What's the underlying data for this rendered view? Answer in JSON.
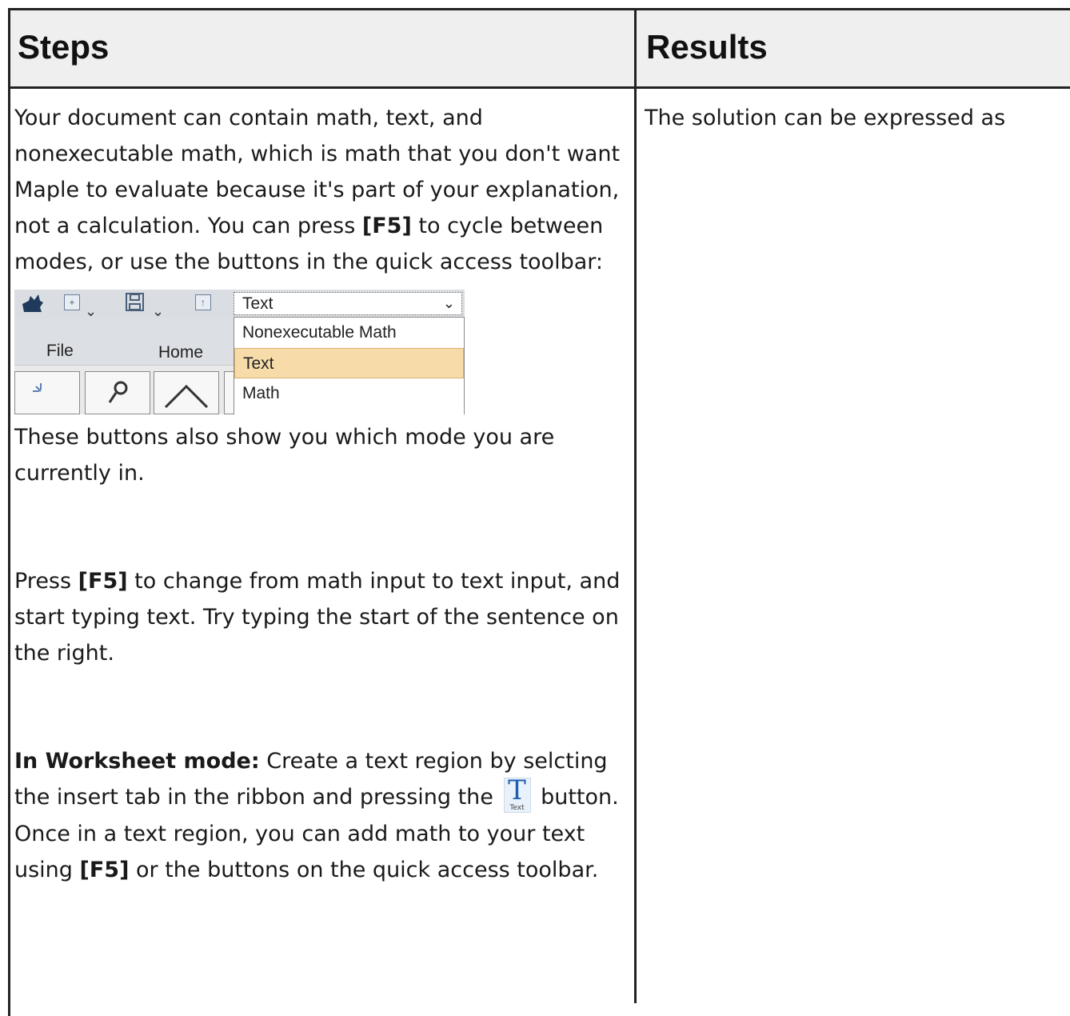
{
  "header": {
    "steps": "Steps",
    "results": "Results"
  },
  "steps": {
    "para1": "Your document can contain math, text, and nonexecutable math, which is math that you don't want Maple to evaluate because it's part of your explanation, not a calculation. You can press ",
    "para1_key": "[F5]",
    "para1_end": " to cycle between modes, or use the buttons in the quick access toolbar:",
    "para2": "These buttons also show you which mode you are currently in.",
    "para3_start": "Press ",
    "para3_key": "[F5]",
    "para3_end": " to change from math input to text input, and start typing text. Try typing the start of the sentence on the right.",
    "para4_bold": "In Worksheet mode:",
    "para4_a": " Create a text region by selcting the insert tab in the ribbon and pressing the ",
    "para4_b": " button. Once in a text region, you can add math to your text using ",
    "para4_key": "[F5]",
    "para4_c": " or the buttons on the quick access toolbar."
  },
  "toolbar_shot": {
    "tabs": [
      "File",
      "Home"
    ],
    "selected_value": "Text",
    "options": [
      "Nonexecutable Math",
      "Text",
      "Math"
    ],
    "selected_index": 1,
    "text_icon": {
      "glyph": "T",
      "caption": "Text"
    }
  },
  "results": {
    "text": "The solution can be expressed as"
  }
}
